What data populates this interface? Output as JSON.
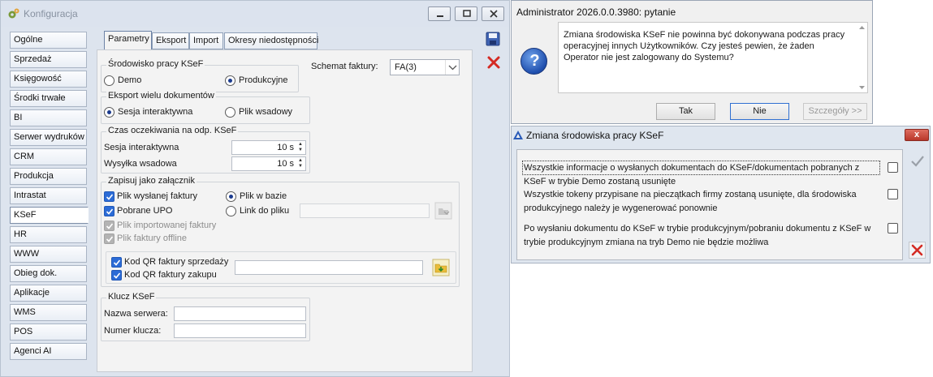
{
  "config_window": {
    "title": "Konfiguracja",
    "nav": [
      "Ogólne",
      "Sprzedaż",
      "Księgowość",
      "Środki trwałe",
      "BI",
      "Serwer wydruków",
      "CRM",
      "Produkcja",
      "Intrastat",
      "KSeF",
      "HR",
      "WWW",
      "Obieg dok.",
      "Aplikacje",
      "WMS",
      "POS",
      "Agenci AI"
    ],
    "active_nav": "KSeF",
    "tabs": [
      "Parametry",
      "Eksport",
      "Import",
      "Okresy niedostępności"
    ],
    "active_tab": "Parametry",
    "env": {
      "legend": "Środowisko pracy KSeF",
      "demo": "Demo",
      "prod": "Produkcyjne",
      "selected": "Produkcyjne"
    },
    "schema": {
      "label": "Schemat faktury:",
      "value": "FA(3)"
    },
    "export": {
      "legend": "Eksport wielu dokumentów",
      "interactive": "Sesja interaktywna",
      "batch": "Plik wsadowy",
      "selected": "Sesja interaktywna"
    },
    "wait": {
      "legend": "Czas oczekiwania na odp. KSeF",
      "interactive_label": "Sesja interaktywna",
      "interactive_value": "10 s",
      "batch_label": "Wysyłka wsadowa",
      "batch_value": "10 s"
    },
    "attach": {
      "legend": "Zapisuj jako załącznik",
      "sent_file": "Plik wysłanej faktury",
      "upo": "Pobrane UPO",
      "imported_file": "Plik importowanej faktury",
      "offline_file": "Plik faktury offline",
      "in_db": "Plik w bazie",
      "link": "Link do pliku",
      "qr_sales": "Kod QR faktury sprzedaży",
      "qr_purchase": "Kod QR faktury zakupu"
    },
    "key": {
      "legend": "Klucz KSeF",
      "server_label": "Nazwa serwera:",
      "number_label": "Numer klucza:",
      "server_value": "",
      "number_value": ""
    }
  },
  "question_dialog": {
    "title": "Administrator 2026.0.0.3980: pytanie",
    "message": "Zmiana środowiska KSeF nie powinna być dokonywana podczas pracy operacyjnej innych Użytkowników. Czy jesteś pewien, że żaden Operator nie jest zalogowany do Systemu?",
    "yes": "Tak",
    "no": "Nie",
    "details": "Szczegóły >>"
  },
  "env_dialog": {
    "title": "Zmiana środowiska pracy KSeF",
    "close": "x",
    "items": [
      "Wszystkie informacje o wysłanych dokumentach do KSeF/dokumentach pobranych z KSeF w trybie Demo zostaną usunięte",
      "Wszystkie tokeny przypisane na pieczątkach firmy zostaną usunięte, dla środowiska produkcyjnego należy je wygenerować ponownie",
      "Po wysłaniu dokumentu do KSeF w trybie produkcyjnym/pobraniu dokumentu z KSeF w trybie produkcyjnym zmiana na tryb Demo nie będzie możliwa"
    ]
  }
}
